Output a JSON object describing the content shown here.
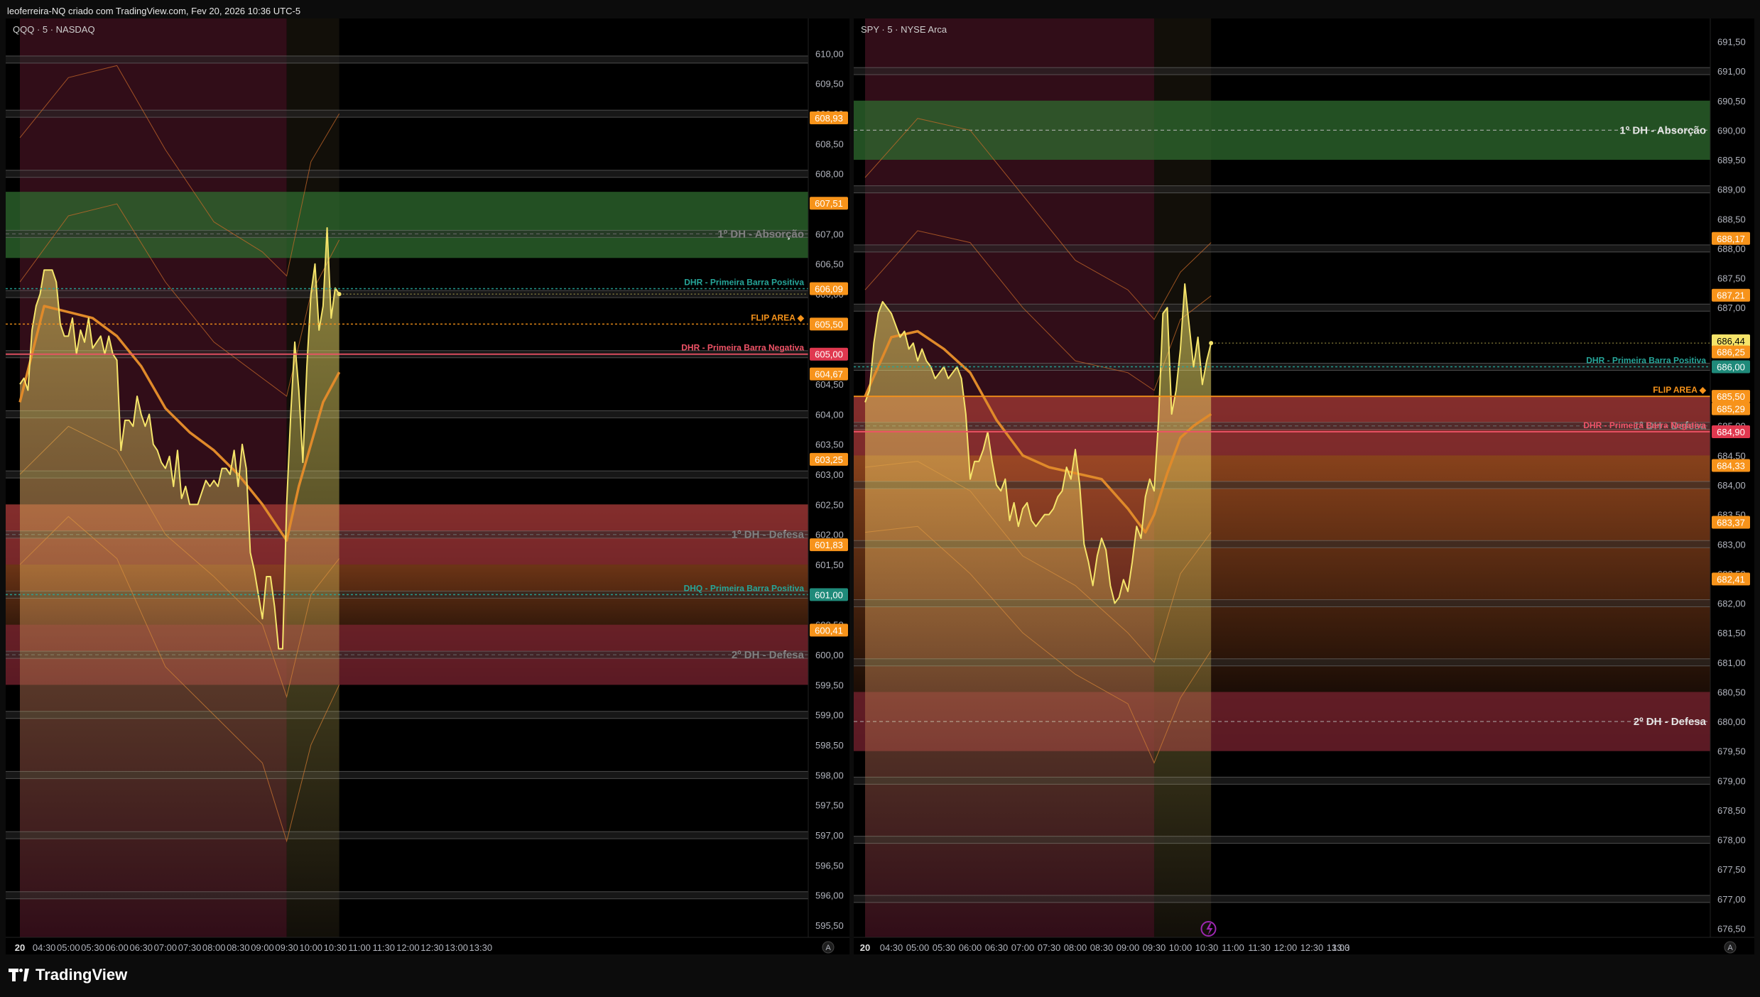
{
  "caption": "leoferreira-NQ criado com TradingView.com, Fev 20, 2026 10:36 UTC-5",
  "brand": "TradingView",
  "colors": {
    "background": "#000000",
    "price_line": "#f5e46a",
    "vwap": "#e08a2a",
    "band_line": "#c8692a",
    "zone_green": "#2f6b2f",
    "zone_red": "#7a2330",
    "zone_orange": "#d9692c",
    "session_bg": "#3a0f1c",
    "label_orange": "#f7931a",
    "label_teal": "#1f8a7a",
    "label_red": "#e0384f",
    "label_yellow": "#f5e46a",
    "text_teal": "#26a69a",
    "text_red": "#f05367"
  },
  "chart_data": [
    {
      "type": "line",
      "symbol": "QQQ · 5 · NASDAQ",
      "time_labels": [
        "20",
        "04:30",
        "05:00",
        "05:30",
        "06:00",
        "06:30",
        "07:00",
        "07:30",
        "08:00",
        "08:30",
        "09:00",
        "09:30",
        "10:00",
        "10:30",
        "11:00",
        "11:30",
        "12:00",
        "12:30",
        "13:00",
        "13:30"
      ],
      "price_ticks": [
        "610,00",
        "609,50",
        "609,00",
        "608,50",
        "608,00",
        "607,50",
        "607,00",
        "606,50",
        "606,00",
        "605,50",
        "605,00",
        "604,50",
        "604,00",
        "603,50",
        "603,00",
        "602,50",
        "602,00",
        "601,50",
        "601,00",
        "600,50",
        "600,00",
        "599,50",
        "599,00",
        "598,50",
        "598,00",
        "597,50",
        "597,00",
        "596,50",
        "596,00",
        "595,50"
      ],
      "ylim": [
        595.3,
        610.3
      ],
      "session": {
        "premarket_start": "04:00",
        "rth_start": "09:30",
        "last_bar": "10:35"
      },
      "price_series": {
        "x": [
          "04:00",
          "04:05",
          "04:10",
          "04:15",
          "04:20",
          "04:25",
          "04:30",
          "04:35",
          "04:40",
          "04:45",
          "04:50",
          "04:55",
          "05:00",
          "05:05",
          "05:10",
          "05:15",
          "05:20",
          "05:25",
          "05:30",
          "05:35",
          "05:40",
          "05:45",
          "05:50",
          "05:55",
          "06:00",
          "06:05",
          "06:10",
          "06:15",
          "06:20",
          "06:25",
          "06:30",
          "06:35",
          "06:40",
          "06:45",
          "06:50",
          "06:55",
          "07:00",
          "07:05",
          "07:10",
          "07:15",
          "07:20",
          "07:25",
          "07:30",
          "07:35",
          "07:40",
          "07:45",
          "07:50",
          "07:55",
          "08:00",
          "08:05",
          "08:10",
          "08:15",
          "08:20",
          "08:25",
          "08:30",
          "08:35",
          "08:40",
          "08:45",
          "08:50",
          "08:55",
          "09:00",
          "09:05",
          "09:10",
          "09:15",
          "09:20",
          "09:25",
          "09:30",
          "09:35",
          "09:40",
          "09:45",
          "09:50",
          "09:55",
          "10:00",
          "10:05",
          "10:10",
          "10:15",
          "10:20",
          "10:25",
          "10:30",
          "10:35"
        ],
        "y": [
          604.5,
          604.6,
          604.4,
          605.4,
          605.8,
          606.0,
          606.4,
          606.4,
          606.4,
          606.2,
          605.5,
          605.3,
          605.3,
          605.6,
          605.0,
          605.4,
          605.2,
          605.6,
          605.1,
          605.2,
          605.3,
          605.0,
          605.3,
          605.0,
          604.9,
          603.4,
          603.9,
          603.9,
          603.8,
          604.3,
          604.0,
          603.8,
          604.0,
          603.5,
          603.4,
          603.2,
          603.1,
          603.3,
          602.8,
          603.4,
          602.6,
          602.8,
          602.5,
          602.5,
          602.5,
          602.7,
          602.9,
          602.8,
          602.9,
          602.8,
          603.1,
          603.1,
          603.0,
          603.4,
          602.8,
          603.5,
          603.1,
          601.7,
          601.4,
          601.0,
          600.6,
          601.3,
          601.3,
          600.8,
          600.1,
          600.1,
          602.5,
          604.0,
          605.2,
          604.4,
          603.2,
          604.8,
          606.0,
          606.5,
          605.4,
          605.8,
          607.1,
          605.6,
          606.1,
          606.0
        ]
      },
      "vwap_series": {
        "x": [
          "04:00",
          "04:30",
          "05:00",
          "05:30",
          "06:00",
          "06:30",
          "07:00",
          "07:30",
          "08:00",
          "08:30",
          "09:00",
          "09:30",
          "09:45",
          "10:00",
          "10:15",
          "10:35"
        ],
        "y": [
          604.2,
          605.8,
          605.7,
          605.6,
          605.3,
          604.8,
          604.1,
          603.7,
          603.4,
          603.0,
          602.5,
          601.9,
          602.8,
          603.5,
          604.2,
          604.7
        ]
      },
      "band_series": [
        {
          "x": [
            "04:00",
            "05:00",
            "06:00",
            "07:00",
            "08:00",
            "09:00",
            "09:30",
            "10:00",
            "10:35"
          ],
          "y": [
            608.6,
            609.6,
            609.8,
            608.4,
            607.2,
            606.7,
            606.3,
            608.2,
            609.0
          ]
        },
        {
          "x": [
            "04:00",
            "05:00",
            "06:00",
            "07:00",
            "08:00",
            "09:00",
            "09:30",
            "10:00",
            "10:35"
          ],
          "y": [
            606.2,
            607.3,
            607.5,
            606.2,
            605.2,
            604.6,
            604.3,
            606.0,
            606.9
          ]
        },
        {
          "x": [
            "04:00",
            "05:00",
            "06:00",
            "07:00",
            "08:00",
            "09:00",
            "09:30",
            "10:00",
            "10:35"
          ],
          "y": [
            603.0,
            603.8,
            603.4,
            602.0,
            601.3,
            600.5,
            599.3,
            601.0,
            601.6
          ]
        },
        {
          "x": [
            "04:00",
            "05:00",
            "06:00",
            "07:00",
            "08:00",
            "09:00",
            "09:30",
            "10:00",
            "10:35"
          ],
          "y": [
            601.5,
            602.3,
            601.6,
            599.8,
            599.0,
            598.2,
            596.9,
            598.5,
            599.5
          ]
        }
      ],
      "zones": [
        {
          "label": "1º DH - Absorção",
          "kind": "green",
          "from": 606.6,
          "to": 607.7,
          "mid": 607.0
        },
        {
          "label": "1º DH - Defesa",
          "kind": "red",
          "from": 601.5,
          "to": 602.5,
          "mid": 602.0
        },
        {
          "label": "2º DH - Defesa",
          "kind": "red",
          "from": 599.5,
          "to": 600.5,
          "mid": 600.0
        }
      ],
      "orange_fade_zone": {
        "from": 599.5,
        "to": 602.5
      },
      "level_lines": [
        {
          "label": "DHR - Primeira Barra Positiva",
          "y": 606.09,
          "color": "teal",
          "style": "dotted"
        },
        {
          "label": "FLIP AREA ◆",
          "y": 605.5,
          "color": "orange",
          "style": "dotted"
        },
        {
          "label": "DHR - Primeira Barra Negativa",
          "y": 605.0,
          "color": "red",
          "style": "solid"
        },
        {
          "label": "DHQ - Primeira Barra Positiva",
          "y": 601.0,
          "color": "teal",
          "style": "dotted"
        }
      ],
      "gray_levels": [
        609.9,
        609.0,
        608.0,
        607.0,
        606.0,
        605.0,
        604.0,
        603.0,
        602.0,
        601.0,
        600.0,
        599.0,
        598.0,
        597.0,
        596.0
      ],
      "price_tags": [
        {
          "value": "608,93",
          "y": 608.93,
          "color": "orange"
        },
        {
          "value": "607,51",
          "y": 607.51,
          "color": "orange"
        },
        {
          "value": "606,09",
          "y": 606.09,
          "color": "orange"
        },
        {
          "value": "605,50",
          "y": 605.5,
          "color": "orange"
        },
        {
          "value": "605,00",
          "y": 605.0,
          "color": "red"
        },
        {
          "value": "604,67",
          "y": 604.67,
          "color": "orange"
        },
        {
          "value": "603,25",
          "y": 603.25,
          "color": "orange"
        },
        {
          "value": "601,83",
          "y": 601.83,
          "color": "orange"
        },
        {
          "value": "601,00",
          "y": 601.0,
          "color": "teal"
        },
        {
          "value": "600,41",
          "y": 600.41,
          "color": "orange"
        }
      ],
      "scale_mode": "A"
    },
    {
      "type": "line",
      "symbol": "SPY · 5 · NYSE Arca",
      "time_labels": [
        "20",
        "04:30",
        "05:00",
        "05:30",
        "06:00",
        "06:30",
        "07:00",
        "07:30",
        "08:00",
        "08:30",
        "09:00",
        "09:30",
        "10:00",
        "10:30",
        "11:00",
        "11:30",
        "12:00",
        "12:30",
        "13:00",
        "13:3"
      ],
      "price_ticks": [
        "691,50",
        "691,00",
        "690,50",
        "690,00",
        "689,50",
        "689,00",
        "688,50",
        "688,00",
        "687,50",
        "687,00",
        "686,50",
        "686,00",
        "685,50",
        "685,00",
        "684,50",
        "684,00",
        "683,50",
        "683,00",
        "682,50",
        "682,00",
        "681,50",
        "681,00",
        "680,50",
        "680,00",
        "679,50",
        "679,00",
        "678,50",
        "678,00",
        "677,50",
        "677,00",
        "676,50"
      ],
      "ylim": [
        676.35,
        691.65
      ],
      "session": {
        "premarket_start": "04:00",
        "rth_start": "09:30",
        "last_bar": "10:35"
      },
      "price_series": {
        "x": [
          "04:00",
          "04:05",
          "04:10",
          "04:15",
          "04:20",
          "04:25",
          "04:30",
          "04:35",
          "04:40",
          "04:45",
          "04:50",
          "04:55",
          "05:00",
          "05:05",
          "05:10",
          "05:15",
          "05:20",
          "05:25",
          "05:30",
          "05:35",
          "05:40",
          "05:45",
          "05:50",
          "05:55",
          "06:00",
          "06:05",
          "06:10",
          "06:15",
          "06:20",
          "06:25",
          "06:30",
          "06:35",
          "06:40",
          "06:45",
          "06:50",
          "06:55",
          "07:00",
          "07:05",
          "07:10",
          "07:15",
          "07:20",
          "07:25",
          "07:30",
          "07:35",
          "07:40",
          "07:45",
          "07:50",
          "07:55",
          "08:00",
          "08:05",
          "08:10",
          "08:15",
          "08:20",
          "08:25",
          "08:30",
          "08:35",
          "08:40",
          "08:45",
          "08:50",
          "08:55",
          "09:00",
          "09:05",
          "09:10",
          "09:15",
          "09:20",
          "09:25",
          "09:30",
          "09:35",
          "09:40",
          "09:45",
          "09:50",
          "09:55",
          "10:00",
          "10:05",
          "10:10",
          "10:15",
          "10:20",
          "10:25",
          "10:30",
          "10:35"
        ],
        "y": [
          685.4,
          685.6,
          686.4,
          686.9,
          687.1,
          687.0,
          686.9,
          686.7,
          686.5,
          686.6,
          686.3,
          686.4,
          686.1,
          686.3,
          686.1,
          686.0,
          685.8,
          685.9,
          686.0,
          685.8,
          685.9,
          686.0,
          685.8,
          685.2,
          684.1,
          684.4,
          684.4,
          684.6,
          684.9,
          684.4,
          684.0,
          683.9,
          684.1,
          683.4,
          683.7,
          683.3,
          683.6,
          683.7,
          683.4,
          683.3,
          683.4,
          683.5,
          683.5,
          683.6,
          683.8,
          683.9,
          684.3,
          684.1,
          684.6,
          684.0,
          683.0,
          682.7,
          682.3,
          682.8,
          683.1,
          682.9,
          682.3,
          682.0,
          682.1,
          682.4,
          682.2,
          682.7,
          683.3,
          683.1,
          683.8,
          684.1,
          683.9,
          685.1,
          686.9,
          687.0,
          685.2,
          685.6,
          686.3,
          687.4,
          686.7,
          686.0,
          686.5,
          685.7,
          686.1,
          686.4
        ]
      },
      "vwap_series": {
        "x": [
          "04:00",
          "04:30",
          "05:00",
          "05:30",
          "06:00",
          "06:30",
          "07:00",
          "07:30",
          "08:00",
          "08:30",
          "09:00",
          "09:20",
          "09:30",
          "09:45",
          "10:00",
          "10:15",
          "10:35"
        ],
        "y": [
          685.5,
          686.5,
          686.6,
          686.3,
          685.9,
          685.1,
          684.5,
          684.3,
          684.2,
          684.1,
          683.6,
          683.2,
          683.5,
          684.2,
          684.8,
          685.0,
          685.2
        ]
      },
      "band_series": [
        {
          "x": [
            "04:00",
            "05:00",
            "06:00",
            "07:00",
            "08:00",
            "09:00",
            "09:30",
            "10:00",
            "10:35"
          ],
          "y": [
            689.2,
            690.2,
            690.0,
            688.9,
            687.8,
            687.3,
            686.8,
            687.6,
            688.1
          ]
        },
        {
          "x": [
            "04:00",
            "05:00",
            "06:00",
            "07:00",
            "08:00",
            "09:00",
            "09:30",
            "10:00",
            "10:35"
          ],
          "y": [
            687.3,
            688.3,
            688.1,
            687.0,
            686.1,
            685.9,
            685.6,
            686.8,
            687.2
          ]
        },
        {
          "x": [
            "04:00",
            "05:00",
            "06:00",
            "07:00",
            "08:00",
            "09:00",
            "09:30",
            "10:00",
            "10:35"
          ],
          "y": [
            684.3,
            684.4,
            683.9,
            682.8,
            682.3,
            681.5,
            681.0,
            682.5,
            683.2
          ]
        },
        {
          "x": [
            "04:00",
            "05:00",
            "06:00",
            "07:00",
            "08:00",
            "09:00",
            "09:30",
            "10:00",
            "10:35"
          ],
          "y": [
            683.2,
            683.3,
            682.5,
            681.5,
            680.8,
            680.3,
            679.3,
            680.4,
            681.2
          ]
        }
      ],
      "zones": [
        {
          "label": "1º DH - Absorção",
          "kind": "green",
          "from": 689.5,
          "to": 690.5,
          "mid": 690.0
        },
        {
          "label": "1º DH - Defesa",
          "kind": "red",
          "from": 684.5,
          "to": 685.5,
          "mid": 685.0
        },
        {
          "label": "2º DH - Defesa",
          "kind": "red",
          "from": 679.5,
          "to": 680.5,
          "mid": 680.0
        }
      ],
      "orange_fade_zone": {
        "from": 679.5,
        "to": 685.5
      },
      "level_lines": [
        {
          "label": "DHR - Primeira Barra Positiva",
          "y": 686.0,
          "color": "teal",
          "style": "dotted"
        },
        {
          "label": "FLIP AREA ◆",
          "y": 685.5,
          "color": "orange",
          "style": "solid"
        },
        {
          "label": "DHR - Primeira Barra Negativa",
          "y": 684.9,
          "color": "red",
          "style": "solid"
        }
      ],
      "gray_levels": [
        691.0,
        689.0,
        688.0,
        687.0,
        686.0,
        685.0,
        684.0,
        683.0,
        682.0,
        681.0,
        679.0,
        678.0,
        677.0
      ],
      "price_tags": [
        {
          "value": "688,17",
          "y": 688.17,
          "color": "orange"
        },
        {
          "value": "687,21",
          "y": 687.21,
          "color": "orange"
        },
        {
          "value": "686,44",
          "y": 686.44,
          "color": "yellow"
        },
        {
          "value": "686,25",
          "y": 686.25,
          "color": "orange"
        },
        {
          "value": "686,00",
          "y": 686.0,
          "color": "teal"
        },
        {
          "value": "685,50",
          "y": 685.5,
          "color": "orange"
        },
        {
          "value": "685,29",
          "y": 685.29,
          "color": "orange"
        },
        {
          "value": "684,90",
          "y": 684.9,
          "color": "red"
        },
        {
          "value": "684,33",
          "y": 684.33,
          "color": "orange"
        },
        {
          "value": "683,37",
          "y": 683.37,
          "color": "orange"
        },
        {
          "value": "682,41",
          "y": 682.41,
          "color": "orange"
        }
      ],
      "scale_mode": "A",
      "marker_icon": "lightning-icon"
    }
  ]
}
